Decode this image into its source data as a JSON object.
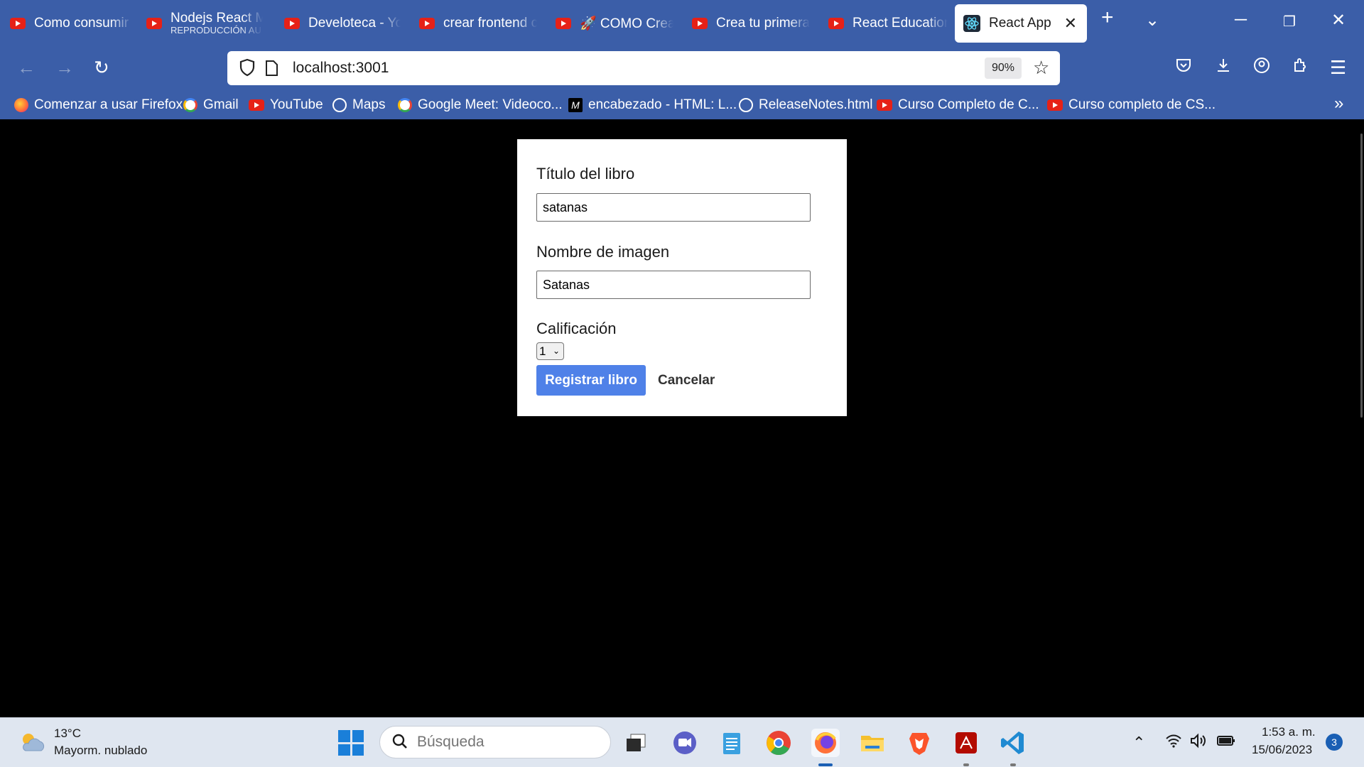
{
  "browser": {
    "tabs": [
      {
        "title": "Como consumir",
        "sub": ""
      },
      {
        "title": "Nodejs React M",
        "sub": "REPRODUCCIÓN AU"
      },
      {
        "title": "Develoteca - Yo",
        "sub": ""
      },
      {
        "title": "crear frontend c",
        "sub": ""
      },
      {
        "title": "🚀 COMO Crea",
        "sub": ""
      },
      {
        "title": "Crea tu primera",
        "sub": ""
      },
      {
        "title": "React Education",
        "sub": ""
      }
    ],
    "active_tab": "React App",
    "url": "localhost:3001",
    "zoom": "90%",
    "bookmarks": [
      "Comenzar a usar Firefox",
      "Gmail",
      "YouTube",
      "Maps",
      "Google Meet: Videoco...",
      "encabezado - HTML: L...",
      "ReleaseNotes.html",
      "Curso Completo de C...",
      "Curso completo de CS..."
    ]
  },
  "form": {
    "title_label": "Título del libro",
    "title_value": "satanas",
    "image_label": "Nombre de imagen",
    "image_value": "Satanas",
    "rating_label": "Calificación",
    "rating_value": "1",
    "submit_label": "Registrar libro",
    "cancel_label": "Cancelar"
  },
  "taskbar": {
    "temperature": "13°C",
    "weather": "Mayorm. nublado",
    "search_placeholder": "Búsqueda",
    "time": "1:53 a. m.",
    "date": "15/06/2023",
    "notifications": "3"
  }
}
